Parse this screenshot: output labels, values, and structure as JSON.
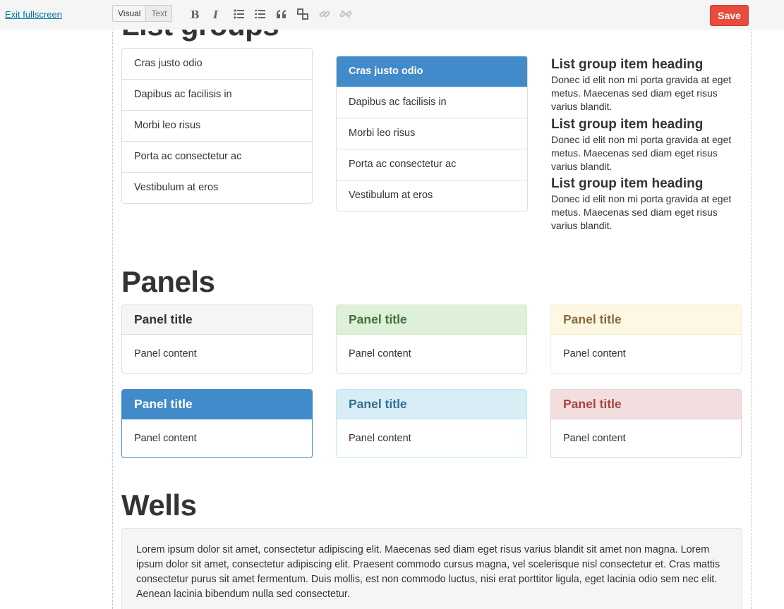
{
  "toolbar": {
    "exit_label": "Exit fullscreen",
    "modes": [
      "Visual",
      "Text"
    ],
    "icons": [
      "bold-icon",
      "italic-icon",
      "bullet-list-icon",
      "numbered-list-icon",
      "blockquote-icon",
      "insert-more-icon",
      "link-icon",
      "unlink-icon"
    ],
    "save_label": "Save",
    "save_color": "#e74c3c"
  },
  "list_groups": {
    "title": "List groups",
    "basic_items": [
      "Cras justo odio",
      "Dapibus ac facilisis in",
      "Morbi leo risus",
      "Porta ac consectetur ac",
      "Vestibulum at eros"
    ],
    "active_items": [
      "Cras justo odio",
      "Dapibus ac facilisis in",
      "Morbi leo risus",
      "Porta ac consectetur ac",
      "Vestibulum at eros"
    ],
    "custom_items": [
      {
        "heading": "List group item heading",
        "text": "Donec id elit non mi porta gravida at eget metus. Maecenas sed diam eget risus varius blandit."
      },
      {
        "heading": "List group item heading",
        "text": "Donec id elit non mi porta gravida at eget metus. Maecenas sed diam eget risus varius blandit."
      },
      {
        "heading": "List group item heading",
        "text": "Donec id elit non mi porta gravida at eget metus. Maecenas sed diam eget risus varius blandit."
      }
    ],
    "active_color": "#428bca"
  },
  "panels": {
    "title": "Panels",
    "items": [
      {
        "variant": "default",
        "title": "Panel title",
        "content": "Panel content"
      },
      {
        "variant": "success",
        "title": "Panel title",
        "content": "Panel content"
      },
      {
        "variant": "warning",
        "title": "Panel title",
        "content": "Panel content"
      },
      {
        "variant": "primary",
        "title": "Panel title",
        "content": "Panel content"
      },
      {
        "variant": "info",
        "title": "Panel title",
        "content": "Panel content"
      },
      {
        "variant": "danger",
        "title": "Panel title",
        "content": "Panel content"
      }
    ]
  },
  "wells": {
    "title": "Wells",
    "text": "Lorem ipsum dolor sit amet, consectetur adipiscing elit. Maecenas sed diam eget risus varius blandit sit amet non magna. Lorem ipsum dolor sit amet, consectetur adipiscing elit. Praesent commodo cursus magna, vel scelerisque nisl consectetur et. Cras mattis consectetur purus sit amet fermentum. Duis mollis, est non commodo luctus, nisi erat porttitor ligula, eget lacinia odio sem nec elit. Aenean lacinia bibendum nulla sed consectetur."
  }
}
